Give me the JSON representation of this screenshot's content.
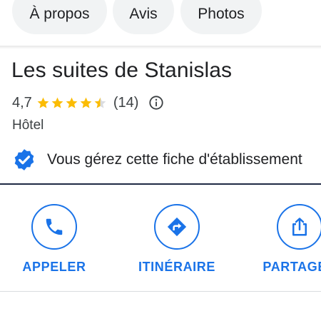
{
  "tabs": [
    {
      "label": "À propos"
    },
    {
      "label": "Avis"
    },
    {
      "label": "Photos"
    }
  ],
  "place": {
    "name": "Les suites de Stanislas",
    "rating": "4,7",
    "stars": 4.5,
    "review_count": "(14)",
    "category": "Hôtel"
  },
  "verified": {
    "text": "Vous gérez cette fiche d'établissement"
  },
  "actions": [
    {
      "label": "APPELER",
      "icon": "phone-icon"
    },
    {
      "label": "ITINÉRAIRE",
      "icon": "directions-icon"
    },
    {
      "label": "PARTAGER",
      "icon": "share-icon"
    }
  ],
  "colors": {
    "accent": "#1a73e8",
    "star": "#fbbc04",
    "star_empty": "#dadce0",
    "verified_badge": "#1a73e8"
  }
}
